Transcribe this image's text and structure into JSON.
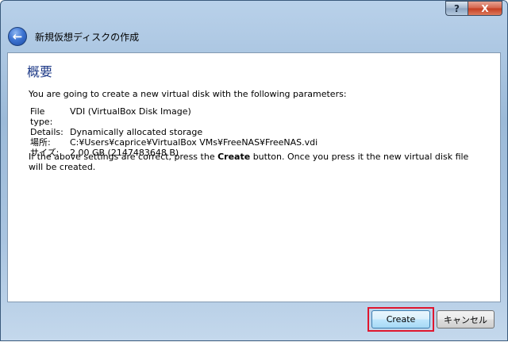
{
  "window": {
    "help_label": "?",
    "close_label": "X",
    "back_icon_glyph": "←",
    "title": "新規仮想ディスクの作成"
  },
  "summary": {
    "heading": "概要",
    "intro": "You are going to create a new virtual disk with the following parameters:",
    "params": [
      {
        "label": "File type:",
        "value": "VDI (VirtualBox Disk Image)"
      },
      {
        "label": "Details:",
        "value": "Dynamically allocated storage"
      },
      {
        "label": "場所:",
        "value": "C:¥Users¥caprice¥VirtualBox VMs¥FreeNAS¥FreeNAS.vdi"
      },
      {
        "label": "サイズ:",
        "value": "2.00 GB (2147483648 B)"
      }
    ],
    "outro_before": "If the above settings are correct, press the ",
    "outro_bold": "Create",
    "outro_after": " button. Once you press it the new virtual disk file will be created."
  },
  "buttons": {
    "create": "Create",
    "cancel": "キャンセル"
  },
  "colors": {
    "highlight": "#e0162e",
    "heading": "#1e3a87"
  }
}
